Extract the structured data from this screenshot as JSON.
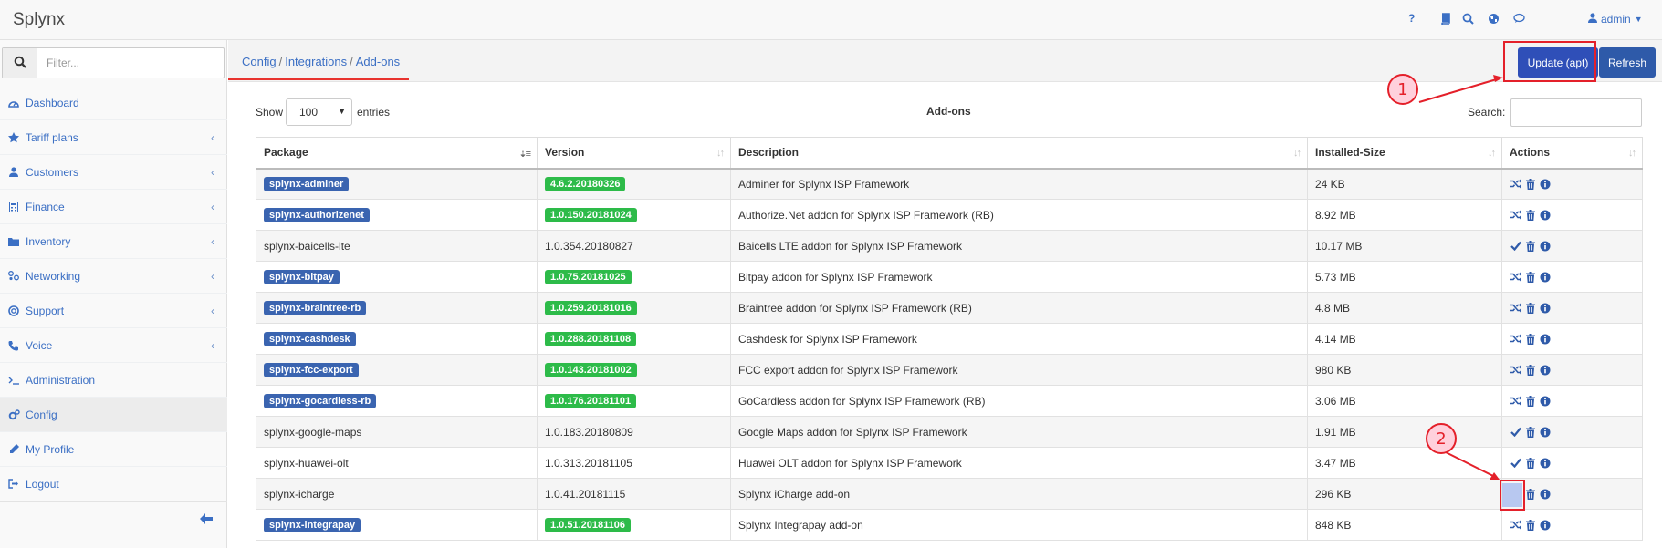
{
  "app": {
    "title": "Splynx"
  },
  "topbar": {
    "icons": [
      "help-icon",
      "book-icon",
      "search-icon",
      "globe-icon",
      "chat-icon"
    ],
    "help_label": "?",
    "user": {
      "name": "admin",
      "icon": "user-icon"
    }
  },
  "sidebar": {
    "filter_placeholder": "Filter...",
    "items": [
      {
        "label": "Dashboard",
        "icon": "dashboard-icon",
        "has_submenu": false
      },
      {
        "label": "Tariff plans",
        "icon": "star-icon",
        "has_submenu": true
      },
      {
        "label": "Customers",
        "icon": "user-icon",
        "has_submenu": true
      },
      {
        "label": "Finance",
        "icon": "calculator-icon",
        "has_submenu": true
      },
      {
        "label": "Inventory",
        "icon": "folder-icon",
        "has_submenu": true
      },
      {
        "label": "Networking",
        "icon": "sitemap-icon",
        "has_submenu": true
      },
      {
        "label": "Support",
        "icon": "lifebuoy-icon",
        "has_submenu": true
      },
      {
        "label": "Voice",
        "icon": "phone-volume-icon",
        "has_submenu": true
      },
      {
        "label": "Administration",
        "icon": "terminal-icon",
        "has_submenu": false
      },
      {
        "label": "Config",
        "icon": "cogs-icon",
        "has_submenu": false,
        "active": true
      },
      {
        "label": "My Profile",
        "icon": "pencil-icon",
        "has_submenu": false
      },
      {
        "label": "Logout",
        "icon": "sign-out-icon",
        "has_submenu": false
      }
    ]
  },
  "breadcrumb": {
    "config": "Config",
    "integrations": "Integrations",
    "current": "Add-ons",
    "sep": "/"
  },
  "toolbar": {
    "update_label": "Update (apt)",
    "refresh_label": "Refresh"
  },
  "table_controls": {
    "show_label": "Show",
    "page_size": "100",
    "entries_label": "entries",
    "caption": "Add-ons",
    "search_label": "Search:"
  },
  "table": {
    "headers": [
      "Package",
      "Version",
      "Description",
      "Installed-Size",
      "Actions"
    ],
    "rows": [
      {
        "package": "splynx-adminer",
        "version": "4.6.2.20180326",
        "description": "Adminer for Splynx ISP Framework",
        "size": "24 KB",
        "installed": true,
        "enabled": false
      },
      {
        "package": "splynx-authorizenet",
        "version": "1.0.150.20181024",
        "description": "Authorize.Net addon for Splynx ISP Framework (RB)",
        "size": "8.92 MB",
        "installed": true,
        "enabled": false
      },
      {
        "package": "splynx-baicells-lte",
        "version": "1.0.354.20180827",
        "description": "Baicells LTE addon for Splynx ISP Framework",
        "size": "10.17 MB",
        "installed": false,
        "enabled": true
      },
      {
        "package": "splynx-bitpay",
        "version": "1.0.75.20181025",
        "description": "Bitpay addon for Splynx ISP Framework",
        "size": "5.73 MB",
        "installed": true,
        "enabled": false
      },
      {
        "package": "splynx-braintree-rb",
        "version": "1.0.259.20181016",
        "description": "Braintree addon for Splynx ISP Framework (RB)",
        "size": "4.8 MB",
        "installed": true,
        "enabled": false
      },
      {
        "package": "splynx-cashdesk",
        "version": "1.0.288.20181108",
        "description": "Cashdesk for Splynx ISP Framework",
        "size": "4.14 MB",
        "installed": true,
        "enabled": false
      },
      {
        "package": "splynx-fcc-export",
        "version": "1.0.143.20181002",
        "description": "FCC export addon for Splynx ISP Framework",
        "size": "980 KB",
        "installed": true,
        "enabled": false
      },
      {
        "package": "splynx-gocardless-rb",
        "version": "1.0.176.20181101",
        "description": "GoCardless addon for Splynx ISP Framework (RB)",
        "size": "3.06 MB",
        "installed": true,
        "enabled": false
      },
      {
        "package": "splynx-google-maps",
        "version": "1.0.183.20180809",
        "description": "Google Maps addon for Splynx ISP Framework",
        "size": "1.91 MB",
        "installed": false,
        "enabled": true
      },
      {
        "package": "splynx-huawei-olt",
        "version": "1.0.313.20181105",
        "description": "Huawei OLT addon for Splynx ISP Framework",
        "size": "3.47 MB",
        "installed": false,
        "enabled": true
      },
      {
        "package": "splynx-icharge",
        "version": "1.0.41.20181115",
        "description": "Splynx iCharge add-on",
        "size": "296 KB",
        "installed": false,
        "enabled": true
      },
      {
        "package": "splynx-integrapay",
        "version": "1.0.51.20181106",
        "description": "Splynx Integrapay add-on",
        "size": "848 KB",
        "installed": true,
        "enabled": false
      }
    ]
  },
  "annotations": {
    "callout1": "1",
    "callout2": "2",
    "color": "#e4202a"
  },
  "colors": {
    "accent": "#3b6fc4",
    "label_blue": "#3a64b0",
    "label_green": "#2dbb49",
    "button_primary": "#2f4fb8",
    "annotation_red": "#e4202a"
  }
}
